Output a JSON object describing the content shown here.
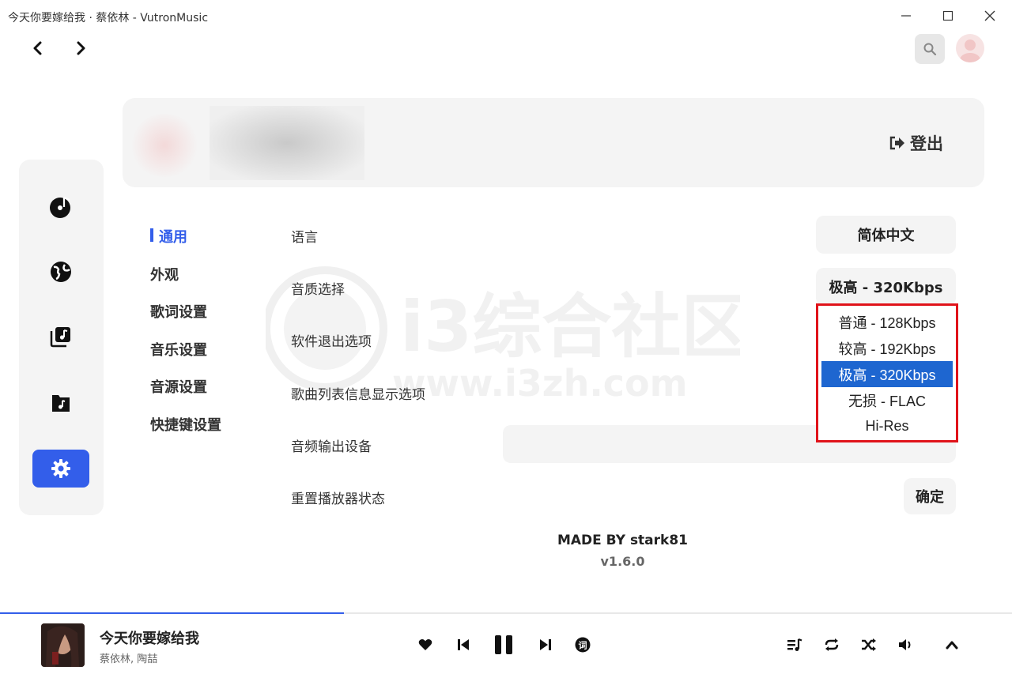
{
  "window": {
    "title": "今天你要嫁给我 · 蔡依林 - VutronMusic",
    "controls": [
      "minimize-icon",
      "maximize-icon",
      "close-icon"
    ]
  },
  "nav": {
    "back_icon": "chevron-left-icon",
    "forward_icon": "chevron-right-icon",
    "search_icon": "search-icon",
    "avatar_icon": "user-avatar-icon"
  },
  "sidebar": {
    "items": [
      {
        "icon": "music-disc-icon"
      },
      {
        "icon": "globe-icon"
      },
      {
        "icon": "music-library-icon"
      },
      {
        "icon": "music-folder-icon"
      },
      {
        "icon": "gear-icon",
        "active": true
      }
    ],
    "accent": "#335eea"
  },
  "profile": {
    "logout_label": "登出",
    "logout_icon": "logout-icon"
  },
  "settings_nav": [
    {
      "label": "通用",
      "active": true
    },
    {
      "label": "外观"
    },
    {
      "label": "歌词设置"
    },
    {
      "label": "音乐设置"
    },
    {
      "label": "音源设置"
    },
    {
      "label": "快捷键设置"
    }
  ],
  "settings": {
    "language": {
      "label": "语言",
      "value": "简体中文"
    },
    "quality": {
      "label": "音质选择",
      "value": "极高 - 320Kbps"
    },
    "exit": {
      "label": "软件退出选项"
    },
    "list_info": {
      "label": "歌曲列表信息显示选项"
    },
    "output": {
      "label": "音频输出设备"
    },
    "reset": {
      "label": "重置播放器状态",
      "button": "确定"
    }
  },
  "quality_dropdown": {
    "options": [
      "普通 - 128Kbps",
      "较高 - 192Kbps",
      "极高 - 320Kbps",
      "无损 - FLAC",
      "Hi-Res"
    ],
    "selected": "极高 - 320Kbps",
    "highlight_color": "#e0131a",
    "selected_color": "#1e66d0"
  },
  "watermark": {
    "line1": "i3综合社区",
    "line2": "www.i3zh.com"
  },
  "footer": {
    "made_by": "MADE BY stark81",
    "version": "v1.6.0"
  },
  "player": {
    "title": "今天你要嫁给我",
    "artist": "蔡依林, 陶喆",
    "progress": 0.34,
    "controls": [
      "heart-icon",
      "previous-icon",
      "pause-icon",
      "next-icon",
      "lyrics-icon"
    ],
    "right_controls": [
      "playlist-icon",
      "repeat-icon",
      "shuffle-icon",
      "volume-icon",
      "chevron-up-icon"
    ],
    "lyrics_glyph": "词"
  }
}
